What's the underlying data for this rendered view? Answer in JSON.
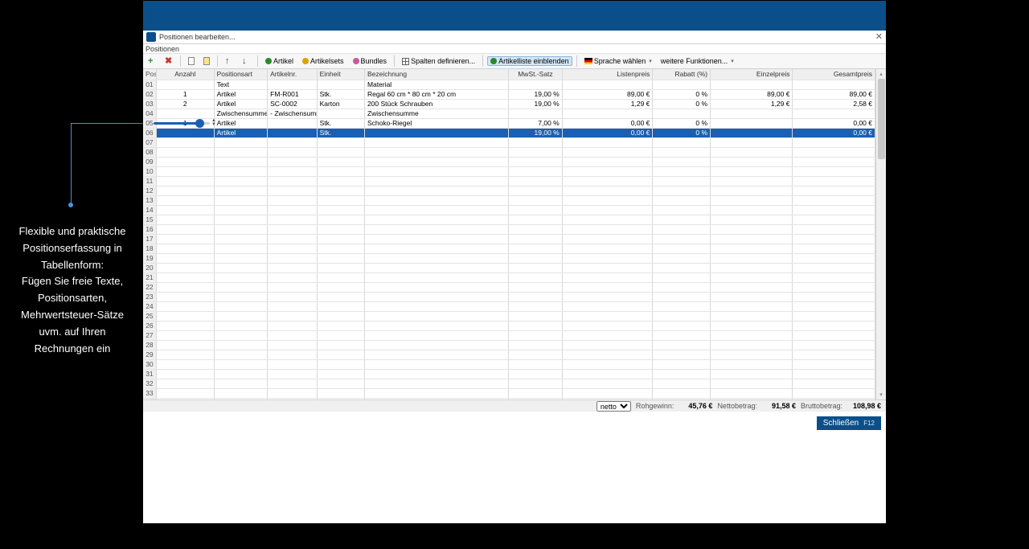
{
  "callout": {
    "lines": [
      "Flexible und praktische",
      "Positionserfassung in",
      "Tabellenform:",
      "Fügen Sie freie Texte,",
      "Positionsarten,",
      "Mehrwertsteuer-Sätze",
      "uvm. auf Ihren",
      "Rechnungen ein"
    ]
  },
  "dialog": {
    "title": "Positionen bearbeiten...",
    "subtitle": "Positionen"
  },
  "toolbar": {
    "artikel": "Artikel",
    "artikelsets": "Artikelsets",
    "bundles": "Bundles",
    "spalten": "Spalten definieren...",
    "artikelliste": "Artikelliste einblenden",
    "sprache": "Sprache wählen",
    "weitere": "weitere Funktionen..."
  },
  "columns": {
    "pos": "Pos.",
    "anzahl": "Anzahl",
    "positionsart": "Positionsart",
    "artikelnr": "Artikelnr.",
    "einheit": "Einheit",
    "bezeichnung": "Bezeichnung",
    "mwst": "MwSt.-Satz",
    "listenpreis": "Listenpreis",
    "rabatt": "Rabatt (%)",
    "einzelpreis": "Einzelpreis",
    "gesamtpreis": "Gesamtpreis"
  },
  "rows": [
    {
      "pos": "01",
      "anzahl": "",
      "positionsart": "Text",
      "artikelnr": "",
      "einheit": "",
      "bezeichnung": "Material",
      "mwst": "",
      "listenpreis": "",
      "rabatt": "",
      "einzelpreis": "",
      "gesamtpreis": ""
    },
    {
      "pos": "02",
      "anzahl": "1",
      "positionsart": "Artikel",
      "artikelnr": "FM-R001",
      "einheit": "Stk.",
      "bezeichnung": "Regal    60 cm * 80 cm * 20 cm",
      "mwst": "19,00 %",
      "listenpreis": "89,00 €",
      "rabatt": "0 %",
      "einzelpreis": "89,00 €",
      "gesamtpreis": "89,00 €"
    },
    {
      "pos": "03",
      "anzahl": "2",
      "positionsart": "Artikel",
      "artikelnr": "SC-0002",
      "einheit": "Karton",
      "bezeichnung": "200 Stück Schrauben",
      "mwst": "19,00 %",
      "listenpreis": "1,29 €",
      "rabatt": "0 %",
      "einzelpreis": "1,29 €",
      "gesamtpreis": "2,58 €"
    },
    {
      "pos": "04",
      "anzahl": "",
      "positionsart": "Zwischensumme",
      "artikelnr": "- Zwischensumme",
      "einheit": "",
      "bezeichnung": "Zwischensumme",
      "mwst": "",
      "listenpreis": "",
      "rabatt": "",
      "einzelpreis": "",
      "gesamtpreis": ""
    },
    {
      "pos": "05",
      "anzahl": "1",
      "positionsart": "Artikel",
      "artikelnr": "",
      "einheit": "Stk.",
      "bezeichnung": "Schoko-Riegel",
      "mwst": "7,00 %",
      "listenpreis": "0,00 €",
      "rabatt": "0 %",
      "einzelpreis": "",
      "gesamtpreis": "0,00 €"
    },
    {
      "pos": "06",
      "anzahl": "",
      "positionsart": "Artikel",
      "artikelnr": "",
      "einheit": "Stk.",
      "bezeichnung": "",
      "mwst": "19,00 %",
      "listenpreis": "0,00 €",
      "rabatt": "0 %",
      "einzelpreis": "",
      "gesamtpreis": "0,00 €",
      "selected": true
    }
  ],
  "emptyRowsStart": 7,
  "emptyRowsEnd": 34,
  "summary": {
    "selectValue": "netto",
    "rohgewinnLabel": "Rohgewinn:",
    "rohgewinnValue": "45,76 €",
    "nettoLabel": "Nettobetrag:",
    "nettoValue": "91,58 €",
    "bruttoLabel": "Bruttobetrag:",
    "bruttoValue": "108,98 €"
  },
  "footer": {
    "closeLabel": "Schließen",
    "closeKey": "F12"
  }
}
